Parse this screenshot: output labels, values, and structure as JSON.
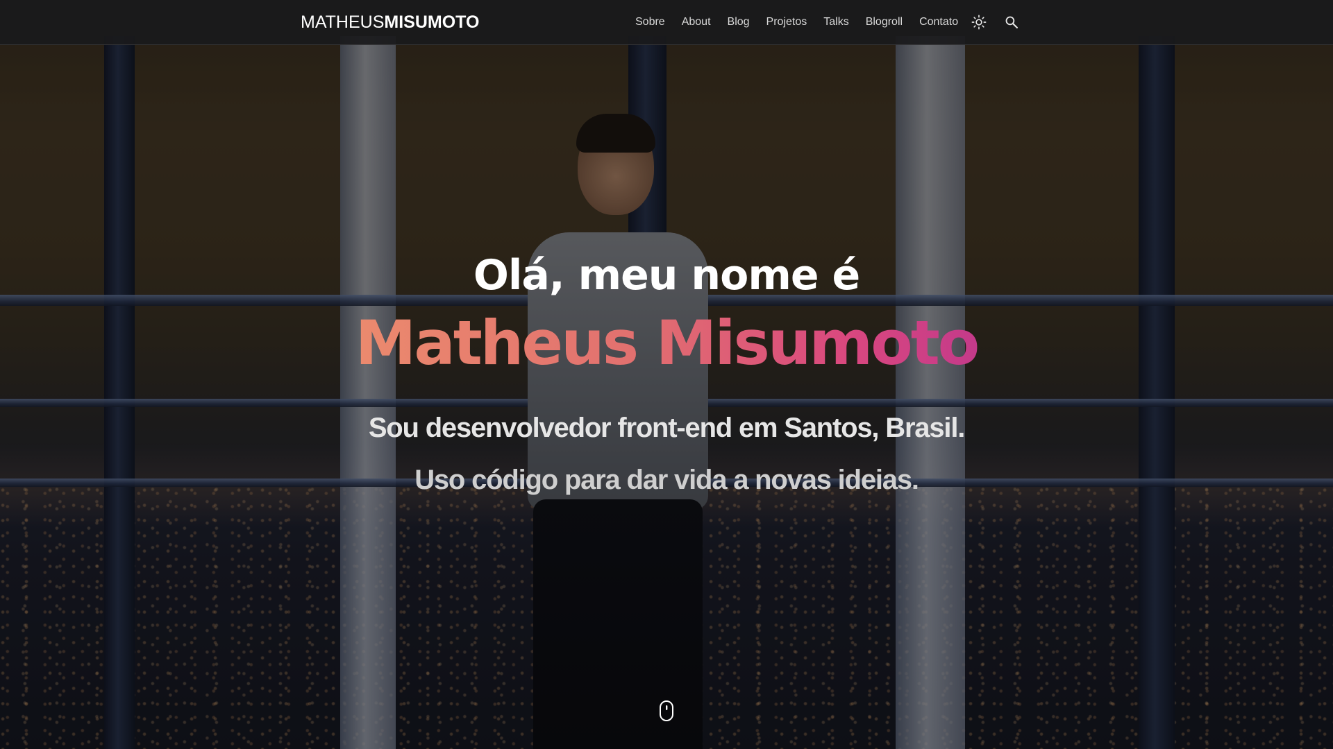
{
  "site": {
    "logo_first": "MATHEUS",
    "logo_last": "MISUMOTO"
  },
  "nav": {
    "items": [
      {
        "label": "Sobre"
      },
      {
        "label": "About"
      },
      {
        "label": "Blog"
      },
      {
        "label": "Projetos"
      },
      {
        "label": "Talks"
      },
      {
        "label": "Blogroll"
      },
      {
        "label": "Contato"
      }
    ],
    "theme_toggle_icon": "sun-icon",
    "search_icon": "search-icon"
  },
  "hero": {
    "greeting": "Olá, meu nome é",
    "name": "Matheus Misumoto",
    "tagline_1": "Sou desenvolvedor front-end em Santos, Brasil.",
    "tagline_2": "Uso código para dar vida a novas ideias.",
    "scroll_icon": "mouse-scroll-icon"
  },
  "colors": {
    "name_gradient_start": "#eb8a6e",
    "name_gradient_end": "#c43a8a",
    "navbar_background": "#1a1a1c",
    "nav_text": "#d9d9d9"
  }
}
